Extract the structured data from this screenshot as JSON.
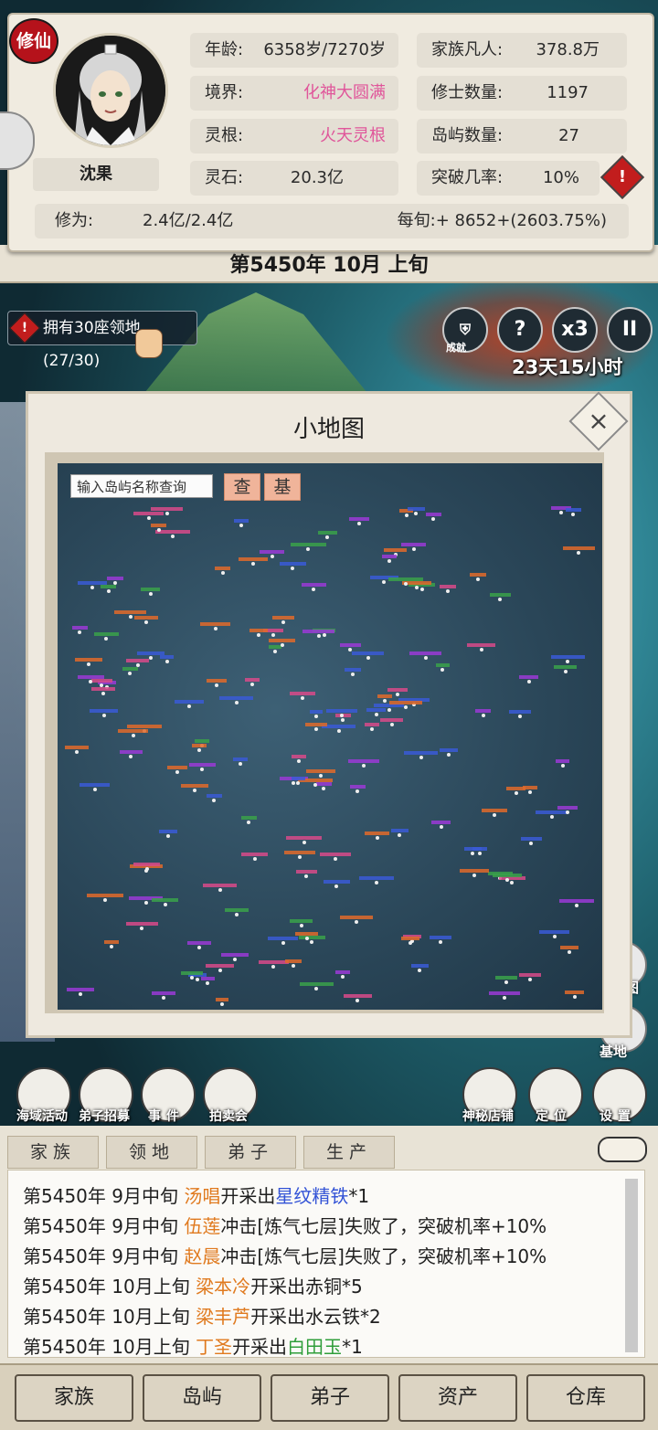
{
  "header": {
    "badge": "修仙",
    "name": "沈果",
    "stats_left": [
      {
        "label": "年龄:",
        "value": "6358岁/7270岁"
      },
      {
        "label": "境界:",
        "value": "化神大圆满"
      },
      {
        "label": "灵根:",
        "value": "火天灵根"
      },
      {
        "label": "灵石:",
        "value": "20.3亿"
      }
    ],
    "stats_right": [
      {
        "label": "家族凡人:",
        "value": "378.8万"
      },
      {
        "label": "修士数量:",
        "value": "1197"
      },
      {
        "label": "岛屿数量:",
        "value": "27"
      },
      {
        "label": "突破几率:",
        "value": "10%"
      }
    ],
    "cultivation_label": "修为:",
    "cultivation_value": "2.4亿/2.4亿",
    "per_period": "每旬:+ 8652+(2603.75%)",
    "alert_glyph": "!",
    "date": "第5450年 10月 上旬"
  },
  "territory": {
    "text": "拥有30座领地(27/30)",
    "warn_glyph": "!"
  },
  "top_buttons": {
    "achievement_label": "成就",
    "help_glyph": "?",
    "speed_label": "x3",
    "pause_glyph": "II",
    "timer": "23天15小时"
  },
  "minimap": {
    "title": "小地图",
    "close_glyph": "×",
    "search_placeholder": "输入岛屿名称查询",
    "search_button": "查",
    "base_button": "基"
  },
  "side_labels": {
    "map_label": "图",
    "base_label": "基地"
  },
  "functions": [
    {
      "label": "海域活动"
    },
    {
      "label": "弟子招募"
    },
    {
      "label": "事件"
    },
    {
      "label": "拍卖会"
    },
    {
      "label": "神秘店铺"
    },
    {
      "label": "定位"
    },
    {
      "label": "设置"
    }
  ],
  "log_tabs": [
    "家族",
    "领地",
    "弟子",
    "生产"
  ],
  "logs": [
    {
      "prefix": "第5450年 9月中旬 ",
      "who": "汤唱",
      "mid": "开采出",
      "item": "星纹精铁",
      "item_color": "blue",
      "suffix": "*1"
    },
    {
      "prefix": "第5450年 9月中旬 ",
      "who": "伍莲",
      "mid": "冲击[炼气七层]失败了，突破机率+10%",
      "item": "",
      "item_color": "",
      "suffix": ""
    },
    {
      "prefix": "第5450年 9月中旬 ",
      "who": "赵晨",
      "mid": "冲击[炼气七层]失败了，突破机率+10%",
      "item": "",
      "item_color": "",
      "suffix": ""
    },
    {
      "prefix": "第5450年 10月上旬 ",
      "who": "梁本冷",
      "mid": "开采出赤铜*5",
      "item": "",
      "item_color": "",
      "suffix": ""
    },
    {
      "prefix": "第5450年 10月上旬 ",
      "who": "梁丰芦",
      "mid": "开采出水云铁*2",
      "item": "",
      "item_color": "",
      "suffix": ""
    },
    {
      "prefix": "第5450年 10月上旬 ",
      "who": "丁圣",
      "mid": "开采出",
      "item": "白田玉",
      "item_color": "green",
      "suffix": "*1"
    }
  ],
  "nav": [
    "家族",
    "岛屿",
    "弟子",
    "资产",
    "仓库"
  ],
  "colors": {
    "accent_red": "#c21d1d",
    "realm_pink": "#e0559a",
    "name_orange": "#e07a1f",
    "item_blue": "#3353d6",
    "item_green": "#2f9e3a"
  }
}
